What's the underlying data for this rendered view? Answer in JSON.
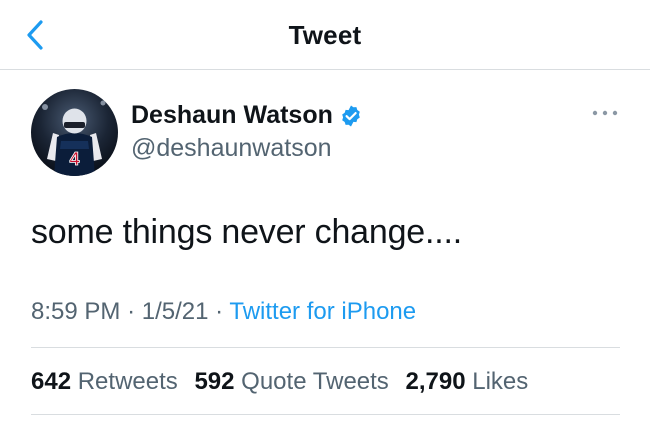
{
  "header": {
    "title": "Tweet",
    "back_icon": "chevron-left-icon"
  },
  "author": {
    "name": "Deshaun Watson",
    "handle": "@deshaunwatson",
    "verified": true,
    "avatar_jersey_number": "4"
  },
  "tweet": {
    "text": "some things never change....",
    "time": "8:59 PM",
    "date": "1/5/21",
    "separator": "·",
    "source": "Twitter for iPhone"
  },
  "stats": {
    "retweets_count": "642",
    "retweets_label": "Retweets",
    "quotes_count": "592",
    "quotes_label": "Quote Tweets",
    "likes_count": "2,790",
    "likes_label": "Likes"
  },
  "colors": {
    "accent": "#1d9bf0",
    "secondary_text": "#536471",
    "primary_text": "#0f1419",
    "divider": "#d9dde0"
  }
}
